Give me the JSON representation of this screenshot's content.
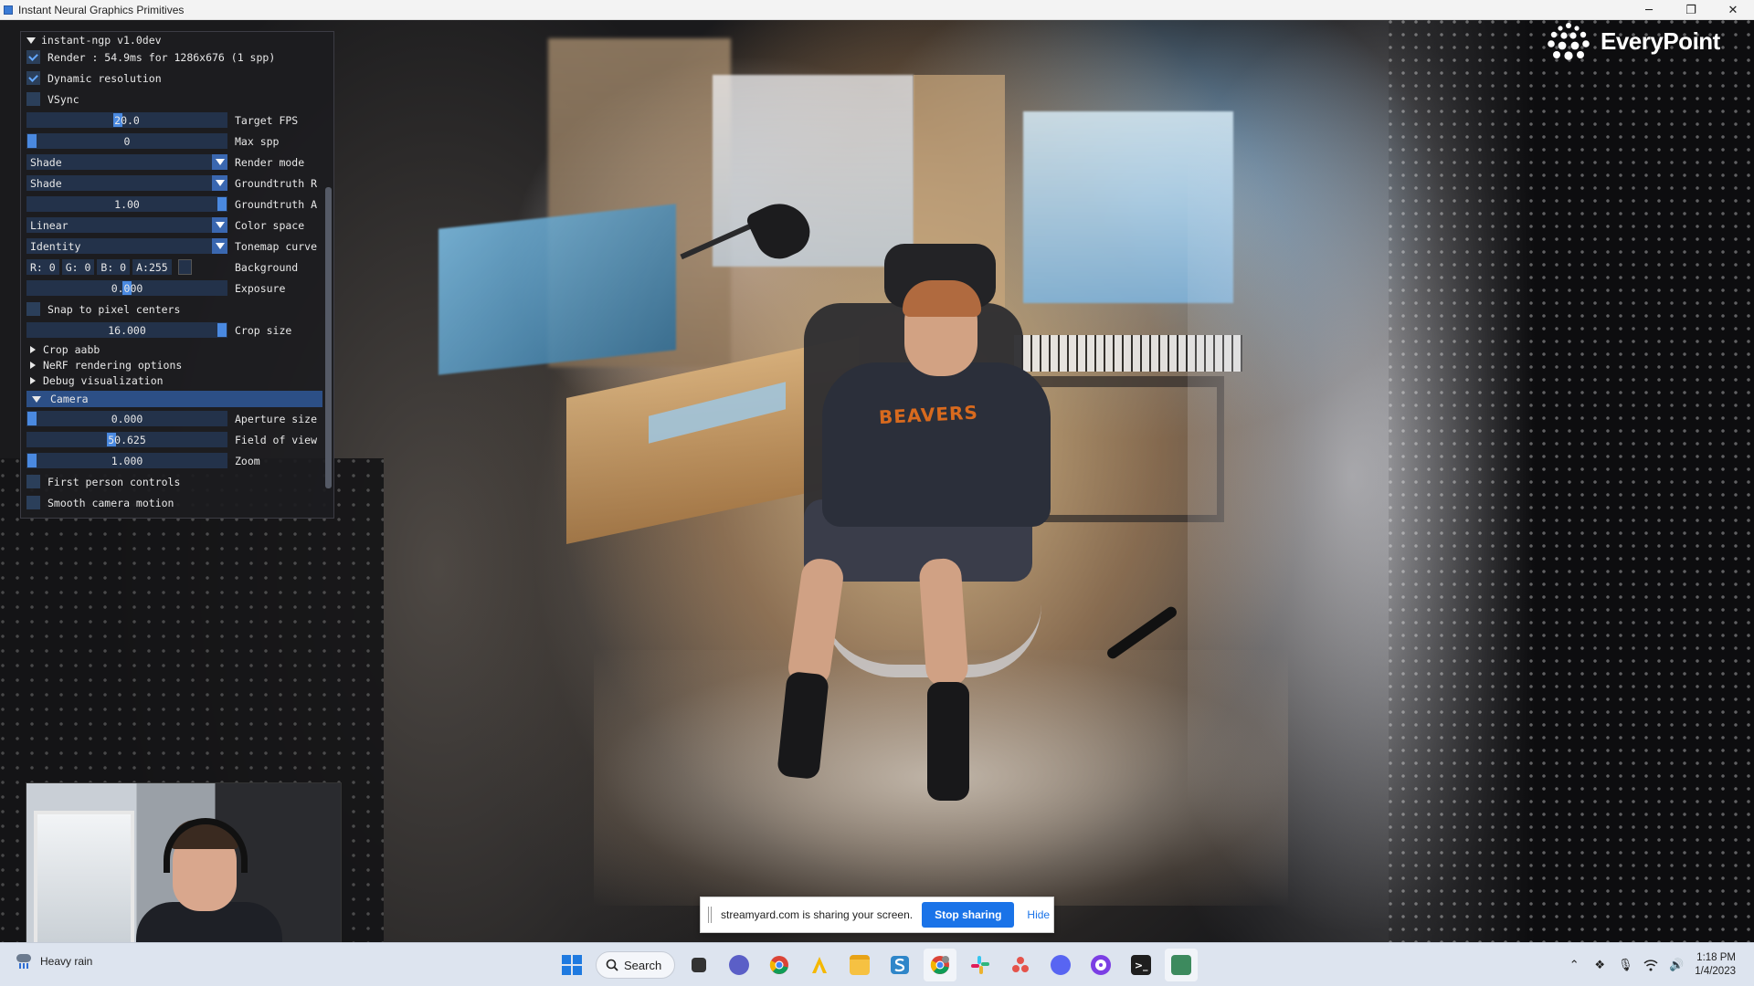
{
  "window": {
    "title": "Instant Neural Graphics Primitives",
    "minimize": "─",
    "maximize": "❐",
    "close": "✕"
  },
  "logo": {
    "text": "EveryPoint"
  },
  "scene": {
    "hoodie_text": "BEAVERS"
  },
  "panel": {
    "header": "instant-ngp v1.0dev",
    "render_label": "Render : 54.9ms for 1286x676 (1 spp)",
    "render_checked": true,
    "dynamic_resolution_label": "Dynamic resolution",
    "dynamic_resolution_checked": true,
    "vsync_label": "VSync",
    "vsync_checked": false,
    "target_fps": {
      "value": "20.0",
      "label": "Target FPS",
      "level": 0.45
    },
    "max_spp": {
      "value": "0",
      "label": "Max spp",
      "level": 0.0
    },
    "render_mode": {
      "value": "Shade",
      "label": "Render mode"
    },
    "groundtruth_r": {
      "value": "Shade",
      "label": "Groundtruth R"
    },
    "groundtruth_a": {
      "value": "1.00",
      "label": "Groundtruth A",
      "level": 1.0
    },
    "color_space": {
      "value": "Linear",
      "label": "Color space"
    },
    "tonemap_curve": {
      "value": "Identity",
      "label": "Tonemap curve"
    },
    "background": {
      "r": "R:  0",
      "g": "G:  0",
      "b": "B:  0",
      "a": "A:255",
      "label": "Background"
    },
    "exposure": {
      "value": "0.000",
      "label": "Exposure",
      "level": 0.5
    },
    "snap_label": "Snap to pixel centers",
    "snap_checked": false,
    "crop_size": {
      "value": "16.000",
      "label": "Crop size",
      "level": 1.0
    },
    "tree_items": [
      "Crop aabb",
      "NeRF rendering options",
      "Debug visualization"
    ],
    "camera_section": "Camera",
    "aperture_size": {
      "value": "0.000",
      "label": "Aperture size",
      "level": 0.0
    },
    "field_of_view": {
      "value": "50.625",
      "label": "Field of view",
      "level": 0.42
    },
    "zoom": {
      "value": "1.000",
      "label": "Zoom",
      "level": 0.0
    },
    "first_person_label": "First person controls",
    "first_person_checked": false,
    "smooth_camera_label": "Smooth camera motion",
    "smooth_camera_checked": false
  },
  "sharebar": {
    "message": "streamyard.com is sharing your screen.",
    "stop_label": "Stop sharing",
    "hide_label": "Hide"
  },
  "taskbar": {
    "weather": "Heavy rain",
    "search_label": "Search",
    "time": "1:18 PM",
    "date": "1/4/2023"
  }
}
